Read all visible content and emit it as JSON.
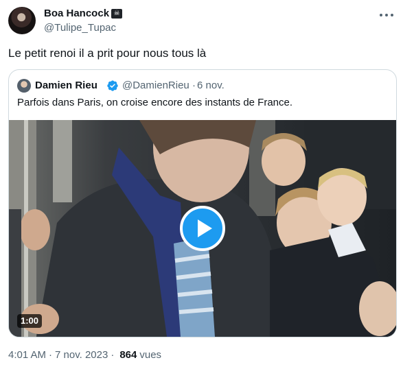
{
  "tweet": {
    "author_name": "Boa Hancock",
    "author_handle": "@Tulipe_Tupac",
    "text": "Le petit renoi il a prit pour nous tous là",
    "time": "4:01 AM",
    "separator": "·",
    "date": "7 nov. 2023",
    "views_count": "864",
    "views_label": "vues"
  },
  "quote": {
    "author_name": "Damien Rieu",
    "author_handle": "@DamienRieu",
    "separator": "·",
    "date": "6 nov.",
    "text": "Parfois dans Paris, on croise encore des instants de France.",
    "video_duration": "1:00"
  },
  "colors": {
    "accent": "#1d9bf0",
    "secondary_text": "#536471",
    "border": "#cfd9de"
  }
}
